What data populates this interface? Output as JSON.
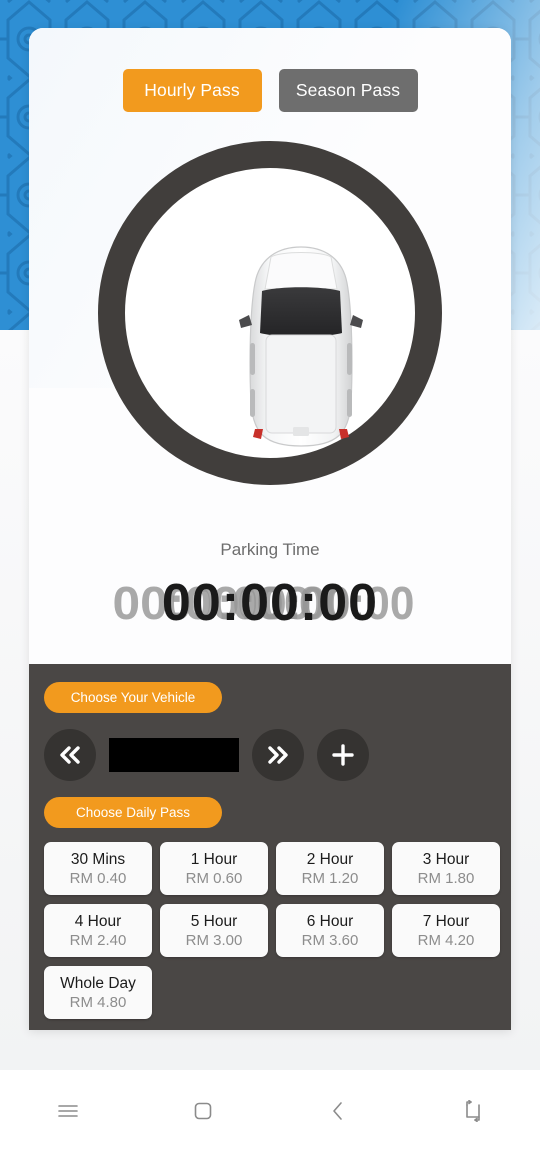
{
  "app": {
    "background_pattern": "islamic-geometric-pattern",
    "accent_color": "#f29a1e",
    "panel_color": "#4a4745",
    "backdrop_color": "#2e8fd4"
  },
  "tabs": {
    "hourly_label": "Hourly Pass",
    "season_label": "Season Pass",
    "active": "Hourly Pass"
  },
  "dial": {
    "vehicle_icon": "car-top-view-icon"
  },
  "parking_time": {
    "label": "Parking Time",
    "value": "00:00:00",
    "ghost_value": "00:00:00"
  },
  "panel": {
    "choose_vehicle_label": "Choose Your Vehicle",
    "choose_daily_label": "Choose Daily Pass",
    "vehicle_selector": {
      "prev_icon": "double-chevron-left-icon",
      "next_icon": "double-chevron-right-icon",
      "add_icon": "plus-icon",
      "plate_value": "",
      "plate_placeholder": ""
    },
    "passes": [
      {
        "duration": "30 Mins",
        "price": "RM 0.40"
      },
      {
        "duration": "1 Hour",
        "price": "RM 0.60"
      },
      {
        "duration": "2 Hour",
        "price": "RM 1.20"
      },
      {
        "duration": "3 Hour",
        "price": "RM 1.80"
      },
      {
        "duration": "4 Hour",
        "price": "RM 2.40"
      },
      {
        "duration": "5 Hour",
        "price": "RM 3.00"
      },
      {
        "duration": "6 Hour",
        "price": "RM 3.60"
      },
      {
        "duration": "7 Hour",
        "price": "RM 4.20"
      },
      {
        "duration": "Whole Day",
        "price": "RM 4.80"
      }
    ]
  },
  "navbar": {
    "items": [
      {
        "icon": "menu-icon"
      },
      {
        "icon": "home-square-icon"
      },
      {
        "icon": "back-chevron-icon"
      },
      {
        "icon": "rotate-screen-icon"
      }
    ]
  }
}
